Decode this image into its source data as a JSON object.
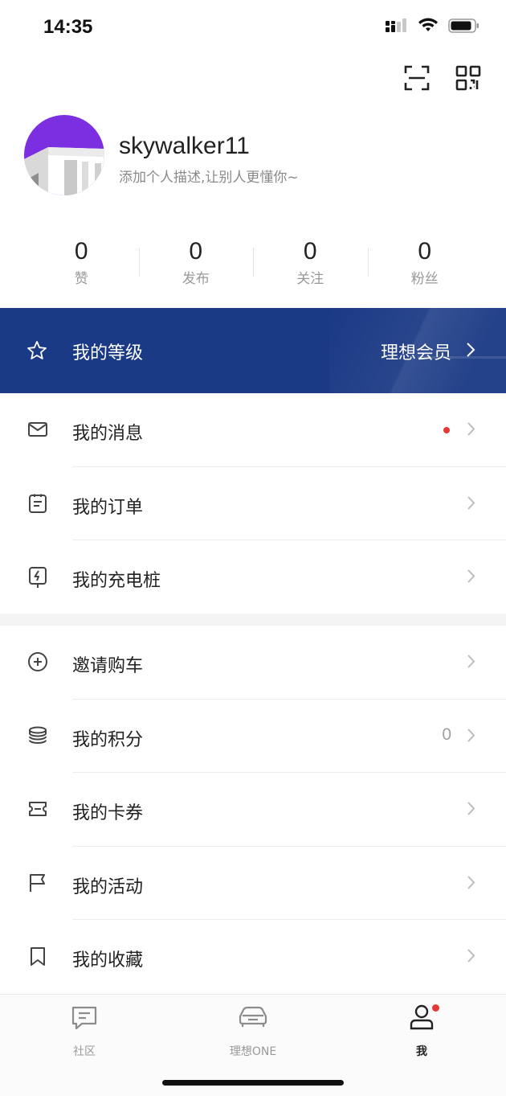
{
  "status_bar": {
    "time": "14:35"
  },
  "profile": {
    "username": "skywalker11",
    "description": "添加个人描述,让别人更懂你~"
  },
  "stats": [
    {
      "value": "0",
      "label": "赞"
    },
    {
      "value": "0",
      "label": "发布"
    },
    {
      "value": "0",
      "label": "关注"
    },
    {
      "value": "0",
      "label": "粉丝"
    }
  ],
  "level": {
    "label": "我的等级",
    "value": "理想会员"
  },
  "menu_group_1": [
    {
      "label": "我的消息",
      "icon": "mail-icon",
      "badge": true
    },
    {
      "label": "我的订单",
      "icon": "order-icon"
    },
    {
      "label": "我的充电桩",
      "icon": "charging-pile-icon"
    }
  ],
  "menu_group_2": [
    {
      "label": "邀请购车",
      "icon": "plus-circle-icon"
    },
    {
      "label": "我的积分",
      "icon": "coins-icon",
      "value": "0"
    },
    {
      "label": "我的卡券",
      "icon": "ticket-icon"
    },
    {
      "label": "我的活动",
      "icon": "flag-icon"
    },
    {
      "label": "我的收藏",
      "icon": "bookmark-icon"
    }
  ],
  "tabbar": [
    {
      "label": "社区",
      "icon": "chat-icon"
    },
    {
      "label": "理想ONE",
      "icon": "car-icon"
    },
    {
      "label": "我",
      "icon": "person-icon",
      "active": true,
      "badge": true
    }
  ],
  "colors": {
    "level_banner": "#1b3a85",
    "badge_red": "#e53935",
    "avatar_purple": "#7b2fe0"
  }
}
